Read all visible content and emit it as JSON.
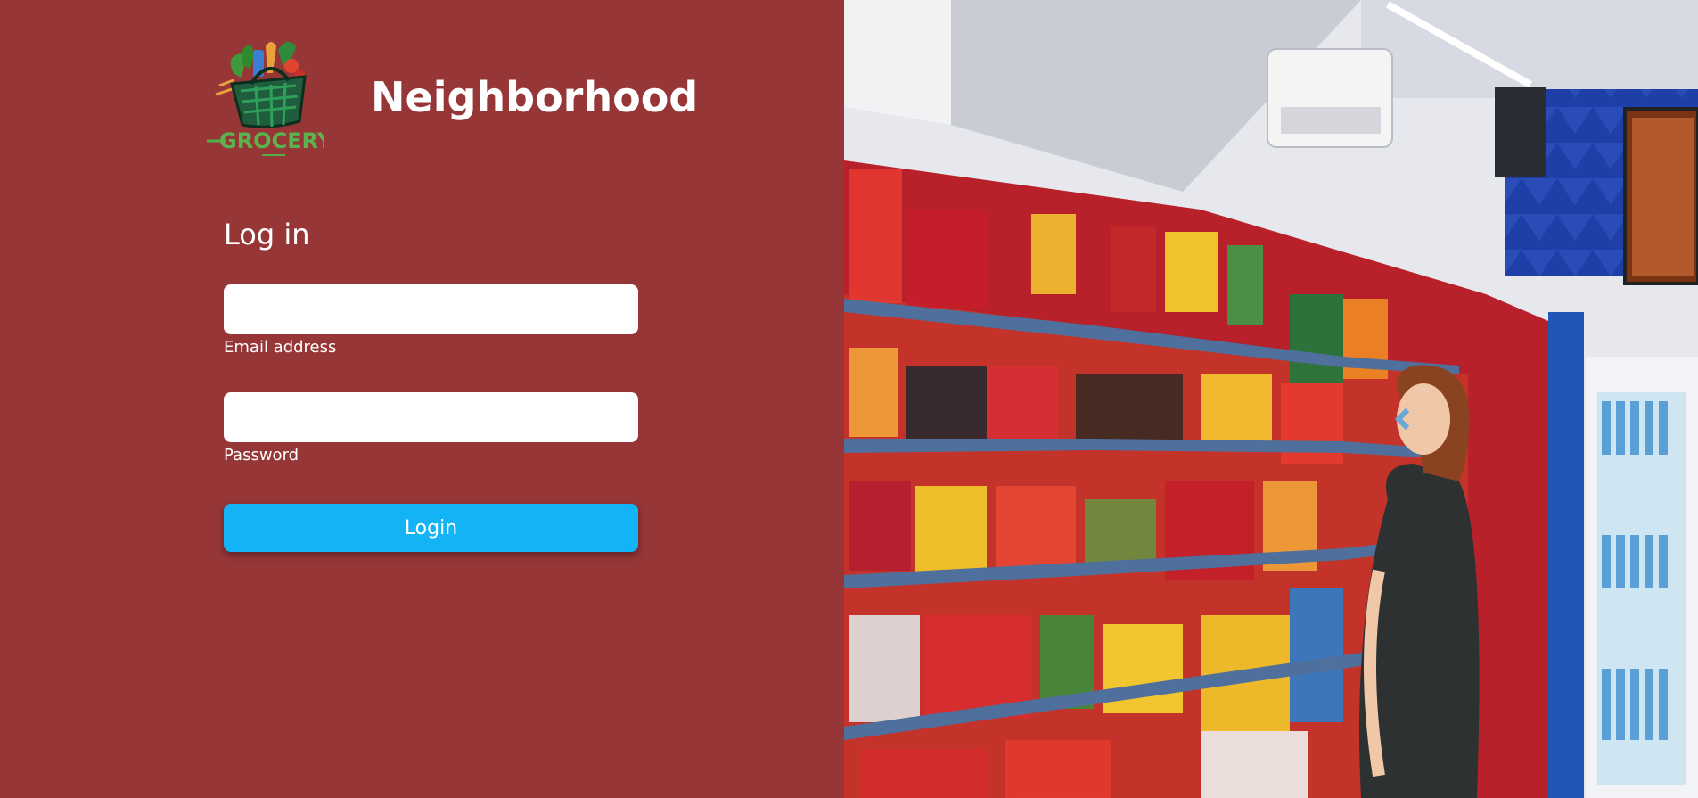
{
  "brand": {
    "logo_text": "GROCERY",
    "name": "Neighborhood"
  },
  "login_form": {
    "heading": "Log in",
    "email": {
      "label": "Email address",
      "value": "",
      "placeholder": ""
    },
    "password": {
      "label": "Password",
      "value": "",
      "placeholder": ""
    },
    "submit_label": "Login"
  },
  "hero_image": {
    "description_icon": "grocery-store-aisle-photo"
  },
  "colors": {
    "panel_bg": "#963637",
    "button_bg": "#13b4f6",
    "text": "#ffffff",
    "logo_green": "#3a8f3a"
  }
}
